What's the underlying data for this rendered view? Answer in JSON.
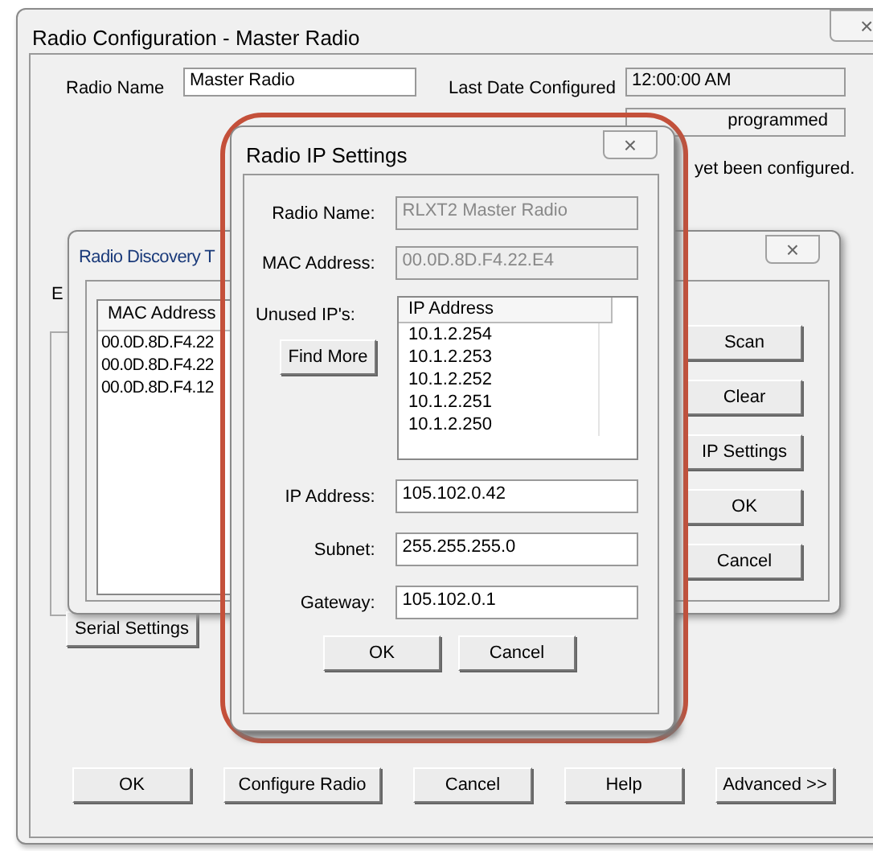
{
  "main_window": {
    "title": "Radio Configuration - Master Radio",
    "close": "×",
    "radio_name_label": "Radio Name",
    "radio_name": "Master Radio",
    "last_date_label": "Last Date Configured",
    "last_date": "12:00:00 AM",
    "last_mac": "programmed",
    "notice": "yet been configured.",
    "tab_fragment": "E",
    "serial_settings_button": "Serial Settings",
    "buttons": [
      "OK",
      "Configure Radio",
      "Cancel",
      "Help",
      "Advanced >>"
    ]
  },
  "discovery_window": {
    "title": "Radio Discovery T",
    "close": "×",
    "list_header": "MAC Address",
    "rows": [
      "00.0D.8D.F4.22",
      "00.0D.8D.F4.22",
      "00.0D.8D.F4.12"
    ],
    "buttons": [
      "Scan",
      "Clear",
      "IP Settings",
      "OK",
      "Cancel"
    ]
  },
  "ip_window": {
    "title": "Radio IP Settings",
    "close": "×",
    "radio_name_label": "Radio Name:",
    "radio_name": "RLXT2 Master Radio",
    "mac_label": "MAC Address:",
    "mac": "00.0D.8D.F4.22.E4",
    "unused_label": "Unused IP's:",
    "find_more_button": "Find More",
    "list_header": "IP Address",
    "unused_ips": [
      "10.1.2.254",
      "10.1.2.253",
      "10.1.2.252",
      "10.1.2.251",
      "10.1.2.250"
    ],
    "fields": [
      {
        "label": "IP Address:",
        "value": "105.102.0.42"
      },
      {
        "label": "Subnet:",
        "value": "255.255.255.0"
      },
      {
        "label": "Gateway:",
        "value": "105.102.0.1"
      }
    ],
    "buttons": [
      "OK",
      "Cancel"
    ]
  }
}
